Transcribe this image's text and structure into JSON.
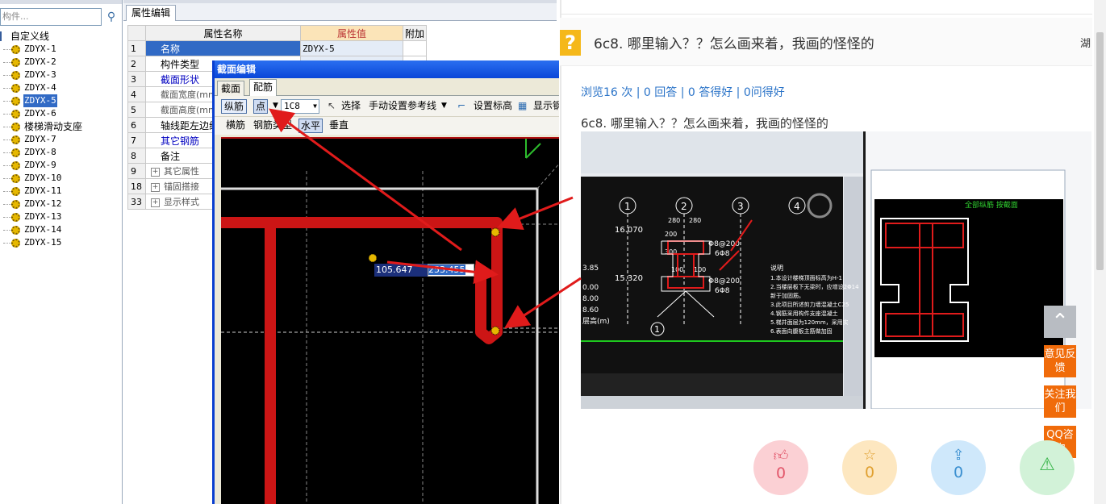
{
  "tree": {
    "search_placeholder": "构件...",
    "root_label": "自定义线",
    "items": [
      "ZDYX-1",
      "ZDYX-2",
      "ZDYX-3",
      "ZDYX-4",
      "ZDYX-5",
      "ZDYX-6",
      "楼梯滑动支座",
      "ZDYX-7",
      "ZDYX-8",
      "ZDYX-9",
      "ZDYX-10",
      "ZDYX-11",
      "ZDYX-12",
      "ZDYX-13",
      "ZDYX-14",
      "ZDYX-15"
    ],
    "selected_index": 4
  },
  "props": {
    "tab_label": "属性编辑",
    "headers": {
      "name": "属性名称",
      "value": "属性值",
      "extra": "附加"
    },
    "rows": [
      {
        "num": "1",
        "name": "名称",
        "value": "ZDYX-5"
      },
      {
        "num": "2",
        "name": "构件类型",
        "value": ""
      },
      {
        "num": "3",
        "name": "截面形状",
        "value": ""
      },
      {
        "num": "4",
        "name": "截面宽度(mm)",
        "value": ""
      },
      {
        "num": "5",
        "name": "截面高度(mm)",
        "value": ""
      },
      {
        "num": "6",
        "name": "轴线距左边线",
        "value": ""
      },
      {
        "num": "7",
        "name": "其它钢筋",
        "value": ""
      },
      {
        "num": "8",
        "name": "备注",
        "value": ""
      },
      {
        "num": "9",
        "name": "其它属性",
        "value": ""
      },
      {
        "num": "18",
        "name": "锚固搭接",
        "value": ""
      },
      {
        "num": "33",
        "name": "显示样式",
        "value": ""
      }
    ]
  },
  "dialog": {
    "title": "截面编辑",
    "tabs": [
      "截面",
      "配筋"
    ],
    "toolbar1": {
      "longitudinal": "纵筋",
      "point": "点",
      "rebar_spec": "1C8",
      "select": "选择",
      "manual_ref": "手动设置参考线",
      "set_elevation": "设置标高",
      "show": "显示钢"
    },
    "toolbar2": {
      "transverse": "横筋",
      "rebar_type": "钢筋类型",
      "horizontal": "水平",
      "vertical": "垂直"
    },
    "coord_x": "105.647",
    "coord_y": "253.455"
  },
  "qa": {
    "question_title": "6c8. 哪里输入？？怎么画来着，我画的怪怪的",
    "region": "湖",
    "stats": "浏览16 次 | 0 回答 | 0 答得好 | 0问得好",
    "body": "6c8. 哪里输入？？怎么画来着，我画的怪怪的",
    "side_buttons": [
      "意见反馈",
      "关注我们",
      "QQ咨询"
    ],
    "actions": [
      {
        "icon": "thumbs-up-icon",
        "count": "0"
      },
      {
        "icon": "star-icon",
        "count": "0"
      },
      {
        "icon": "share-icon",
        "count": "0"
      },
      {
        "icon": "warning-icon",
        "count": ""
      }
    ],
    "cad_labels": {
      "axes": [
        "1",
        "2",
        "3",
        "4"
      ],
      "dims": [
        "280",
        "280",
        "200",
        "300",
        "100",
        "100"
      ],
      "elev": [
        "16.070",
        "15.320"
      ],
      "rebar": [
        "Φ8@200",
        "6Φ8",
        "Φ8@200",
        "6Φ8"
      ],
      "notes_title": "说明",
      "notes": [
        "1.本设计楼梯顶面标高为H-1",
        "2.当楼层板下无梁时，应增设2Φ14",
        "  新于加固筋。",
        "3.此项目所述剪力墙混凝土C25",
        "4.钢筋采用构件支座混凝土",
        "5.梯井面层为120mm，采用实",
        "6.表面向腹板主筋做加固"
      ],
      "right_caption": "全部纵筋 按截面",
      "levels": [
        "3.85",
        "0.00",
        "8.00",
        "8.60"
      ],
      "col_label": "层高(m)"
    }
  }
}
